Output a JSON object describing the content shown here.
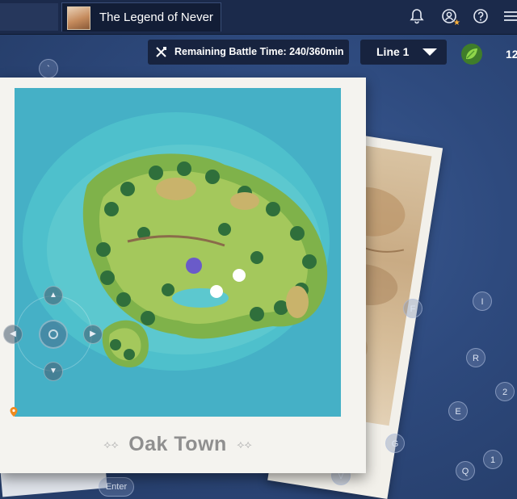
{
  "window": {
    "tab_title": "The Legend of Never",
    "icons": [
      "bell-icon",
      "profile-star-icon",
      "help-icon",
      "menu-icon"
    ]
  },
  "hud": {
    "battle_time_label": "Remaining Battle Time: 240/360min",
    "line_select": "Line 1",
    "leaf_count": "12"
  },
  "map": {
    "location_name": "Oak Town"
  },
  "key_hints": {
    "backtick": "`",
    "f": "F",
    "i": "I",
    "r": "R",
    "e": "E",
    "two": "2",
    "g": "G",
    "one": "1",
    "q": "Q",
    "v": "V",
    "enter": "Enter"
  }
}
